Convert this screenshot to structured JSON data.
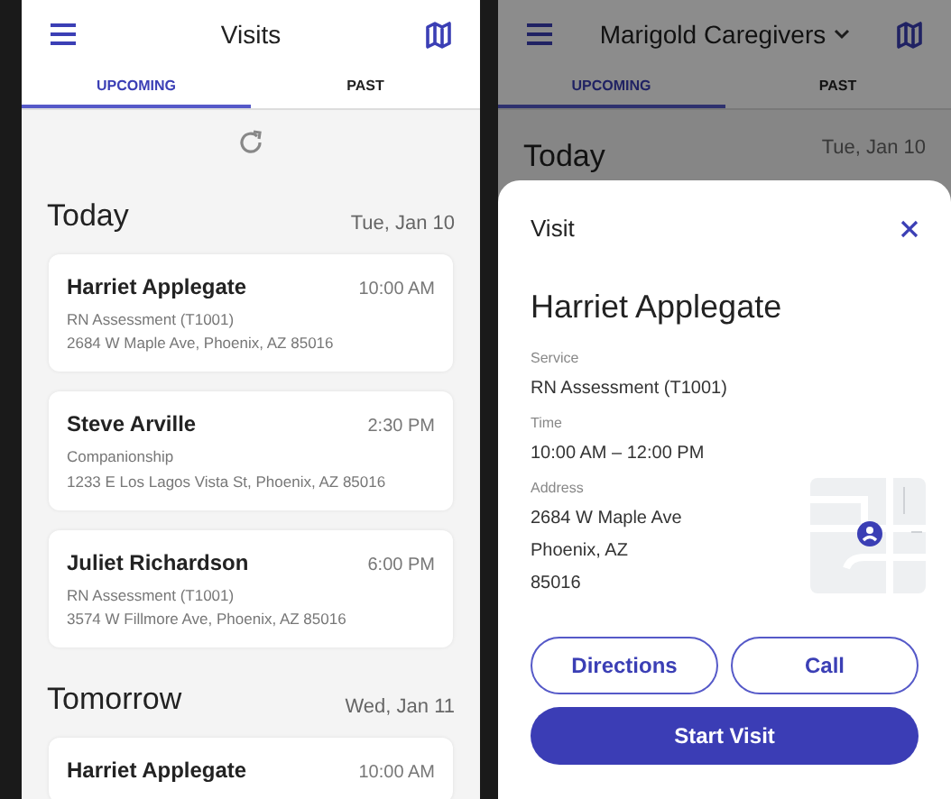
{
  "screens": [
    {
      "kind": "list",
      "header": {
        "title": "Visits",
        "dropdown": false
      },
      "tabs": [
        {
          "label": "UPCOMING",
          "selected": true
        },
        {
          "label": "PAST",
          "selected": false
        }
      ],
      "sections": [
        {
          "title": "Today",
          "date": "Tue, Jan 10",
          "visits": [
            {
              "name": "Harriet Applegate",
              "time": "10:00 AM",
              "service": "RN Assessment (T1001)",
              "address": "2684 W Maple Ave, Phoenix, AZ 85016"
            },
            {
              "name": "Steve Arville",
              "time": "2:30 PM",
              "service": "Companionship",
              "address": "1233 E Los Lagos Vista St, Phoenix, AZ 85016"
            },
            {
              "name": "Juliet Richardson",
              "time": "6:00 PM",
              "service": "RN Assessment (T1001)",
              "address": "3574 W Fillmore Ave, Phoenix, AZ 85016"
            }
          ]
        },
        {
          "title": "Tomorrow",
          "date": "Wed, Jan 11",
          "visits": [
            {
              "name": "Harriet Applegate",
              "time": "10:00 AM"
            }
          ]
        }
      ]
    },
    {
      "kind": "detail",
      "header": {
        "title": "Marigold Caregivers",
        "dropdown": true
      },
      "tabs": [
        {
          "label": "UPCOMING",
          "selected": true
        },
        {
          "label": "PAST",
          "selected": false
        }
      ],
      "sections": [
        {
          "title": "Today",
          "date": "Tue, Jan 10"
        }
      ],
      "sheet": {
        "title": "Visit",
        "name": "Harriet Applegate",
        "fields": [
          {
            "label": "Service",
            "lines": [
              "RN Assessment (T1001)"
            ],
            "map": false
          },
          {
            "label": "Time",
            "lines": [
              "10:00 AM – 12:00 PM"
            ],
            "map": false
          },
          {
            "label": "Address",
            "lines": [
              "2684 W Maple Ave",
              "Phoenix, AZ",
              "85016"
            ],
            "map": true
          }
        ],
        "buttons": [
          {
            "label": "Directions",
            "kind": "outline"
          },
          {
            "label": "Call",
            "kind": "outline"
          },
          {
            "label": "Start Visit",
            "kind": "primary"
          }
        ]
      }
    }
  ]
}
